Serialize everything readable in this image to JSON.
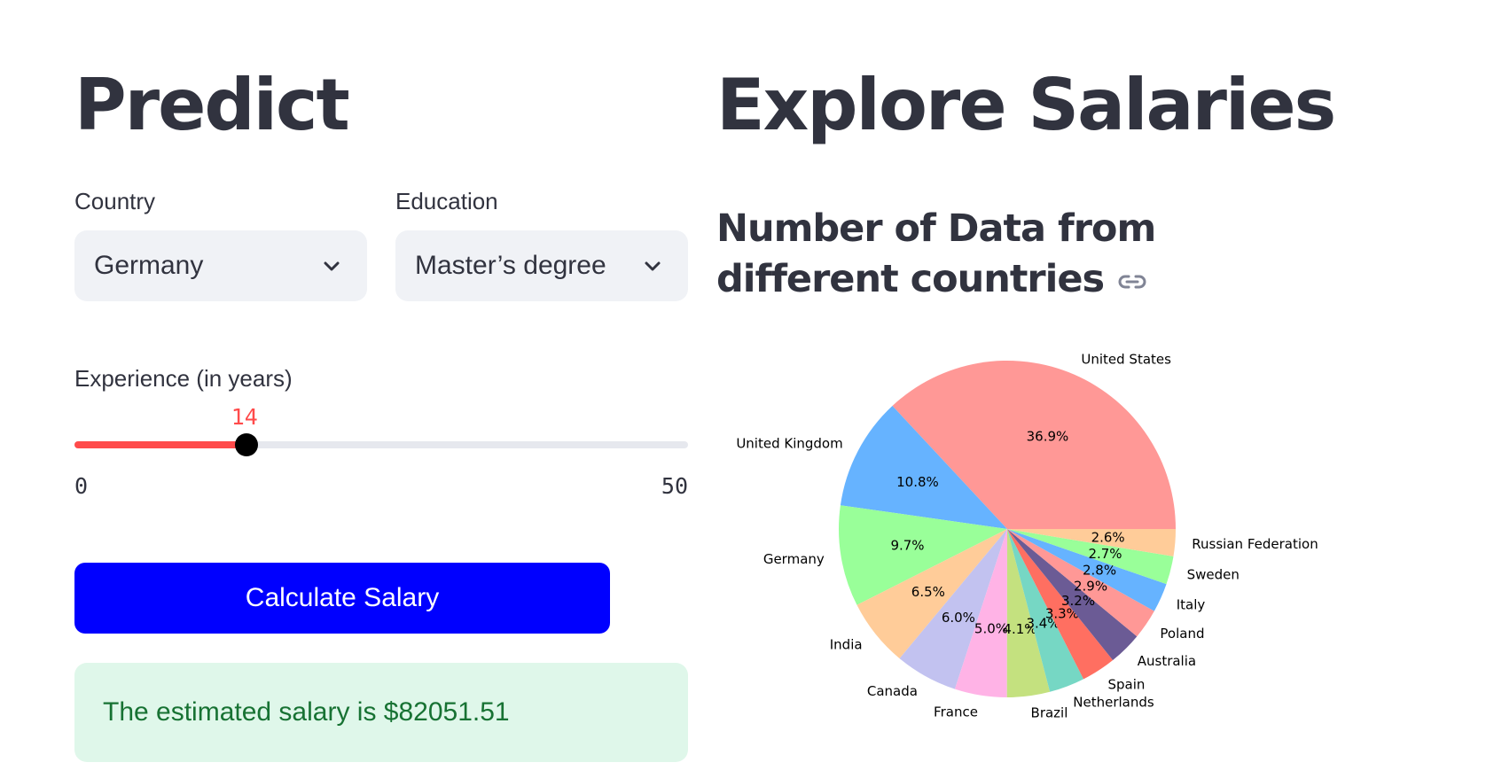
{
  "predict": {
    "title": "Predict",
    "country": {
      "label": "Country",
      "value": "Germany"
    },
    "education": {
      "label": "Education",
      "value": "Master’s degree"
    },
    "experience": {
      "label": "Experience (in years)",
      "value": 14,
      "min": 0,
      "max": 50,
      "value_text": "14",
      "min_text": "0",
      "max_text": "50"
    },
    "calculate_label": "Calculate Salary",
    "result_text": "The estimated salary is $82051.51"
  },
  "explore": {
    "title": "Explore Salaries",
    "subtitle": "Number of Data from different countries"
  },
  "colors": {
    "accent": "#ff4b4b",
    "button": "#0000ff",
    "success_bg": "#dff7ea",
    "success_text": "#177233"
  },
  "chart_data": {
    "type": "pie",
    "title": "",
    "start_angle": 0,
    "direction": "counterclockwise",
    "slices": [
      {
        "label": "United States",
        "value": 36.9,
        "pct_label": "36.9%",
        "color": "#ff9896"
      },
      {
        "label": "United Kingdom",
        "value": 10.8,
        "pct_label": "10.8%",
        "color": "#66b3ff"
      },
      {
        "label": "Germany",
        "value": 9.7,
        "pct_label": "9.7%",
        "color": "#99ff99"
      },
      {
        "label": "India",
        "value": 6.5,
        "pct_label": "6.5%",
        "color": "#ffcc99"
      },
      {
        "label": "Canada",
        "value": 6.0,
        "pct_label": "6.0%",
        "color": "#c2c2f0"
      },
      {
        "label": "France",
        "value": 5.0,
        "pct_label": "5.0%",
        "color": "#ffb3e6"
      },
      {
        "label": "Brazil",
        "value": 4.1,
        "pct_label": "4.1%",
        "color": "#c4e17f"
      },
      {
        "label": "Netherlands",
        "value": 3.4,
        "pct_label": "3.4%",
        "color": "#76d7c4"
      },
      {
        "label": "Spain",
        "value": 3.3,
        "pct_label": "3.3%",
        "color": "#ff6f61"
      },
      {
        "label": "Australia",
        "value": 3.2,
        "pct_label": "3.2%",
        "color": "#6b5b95"
      },
      {
        "label": "Poland",
        "value": 2.9,
        "pct_label": "2.9%",
        "color": "#ff9896"
      },
      {
        "label": "Italy",
        "value": 2.8,
        "pct_label": "2.8%",
        "color": "#66b3ff"
      },
      {
        "label": "Sweden",
        "value": 2.7,
        "pct_label": "2.7%",
        "color": "#99ff99"
      },
      {
        "label": "Russian Federation",
        "value": 2.6,
        "pct_label": "2.6%",
        "color": "#ffcc99"
      }
    ]
  }
}
